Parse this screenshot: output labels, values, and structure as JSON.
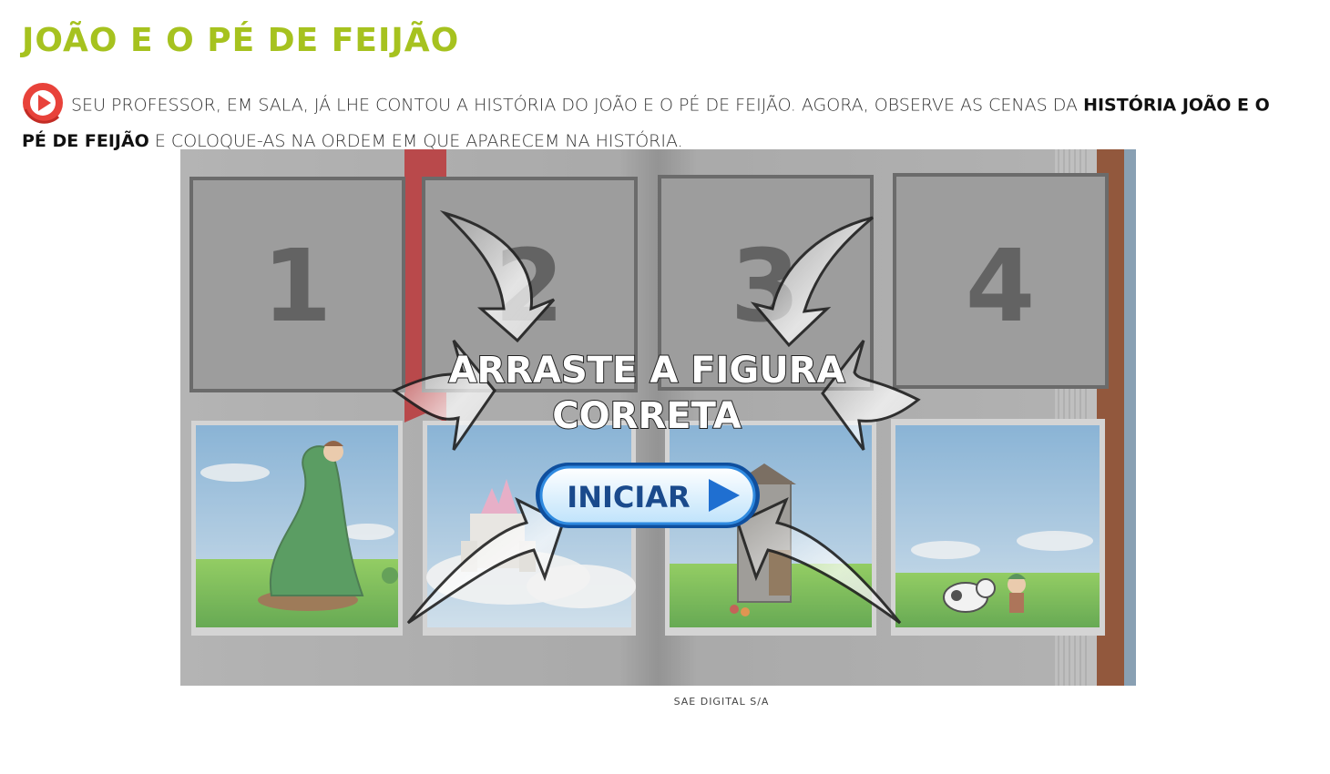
{
  "page": {
    "title": "JOÃO E O PÉ DE FEIJÃO",
    "instruction_part1": "SEU PROFESSOR, EM SALA, JÁ LHE CONTOU A HISTÓRIA DO JOÃO E O PÉ DE FEIJÃO. AGORA, OBSERVE AS CENAS DA ",
    "instruction_bold": "HISTÓRIA JOÃO E O PÉ DE FEIJÃO",
    "instruction_part2": " E COLOQUE-AS NA ORDEM EM QUE APARECEM NA HISTÓRIA.",
    "audio_icon": "play-circle-icon",
    "credit": "SAE DIGITAL S/A"
  },
  "game": {
    "slots": [
      "1",
      "2",
      "3",
      "4"
    ],
    "scenes": [
      "beanstalk-scene",
      "castle-scene",
      "house-scene",
      "cow-scene"
    ],
    "overlay_line1": "ARRASTE A FIGURA",
    "overlay_line2": "CORRETA",
    "start_label": "INICIAR",
    "start_icon": "play-arrow-icon"
  },
  "colors": {
    "title": "#a6c21f",
    "play_icon": "#e8423a",
    "start_button_text": "#1a4a8c",
    "start_button_border": "#1f78d1",
    "book_ribbon": "#c0191c",
    "book_spine": "#7a2a05"
  }
}
